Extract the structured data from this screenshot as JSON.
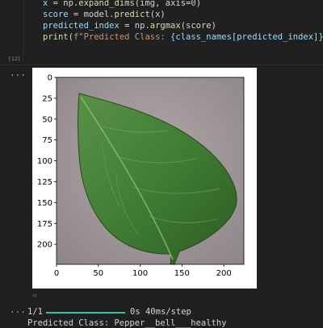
{
  "code": {
    "line1": {
      "lhs": "x",
      "op": " = ",
      "mod": "np.",
      "fn": "expand_dims",
      "args": "(img, axis=",
      "num": "0",
      "end": ")"
    },
    "line2": {
      "lhs": "score",
      "op": " = ",
      "obj": "model.",
      "fn": "predict",
      "args": "(x)"
    },
    "line3": {
      "lhs": "predicted_index",
      "op": " = ",
      "mod": "np.",
      "fn": "argmax",
      "args": "(score)"
    },
    "line4": {
      "fn": "print",
      "open": "(",
      "str1": "f\"Predicted Class: ",
      "expr": "{class_names[predicted_index]}",
      "str2": "\"",
      "close": ")"
    }
  },
  "execution_count": "[12]",
  "output": {
    "ellipsis": "...",
    "progress": {
      "step": "1/1",
      "bar_fraction": 1.0,
      "time": "0s",
      "per_step": "40ms/step"
    },
    "prediction": "Predicted Class: Pepper__bell___healthy"
  },
  "plot": {
    "x_ticks": [
      "0",
      "50",
      "100",
      "150",
      "200"
    ],
    "y_ticks": [
      "0",
      "25",
      "50",
      "75",
      "100",
      "125",
      "150",
      "175",
      "200"
    ],
    "image_description_icon": "leaf-image"
  },
  "colors": {
    "background": "#1f1f1f",
    "progress": "#26c6a9",
    "leaf": "#3f7a33"
  }
}
